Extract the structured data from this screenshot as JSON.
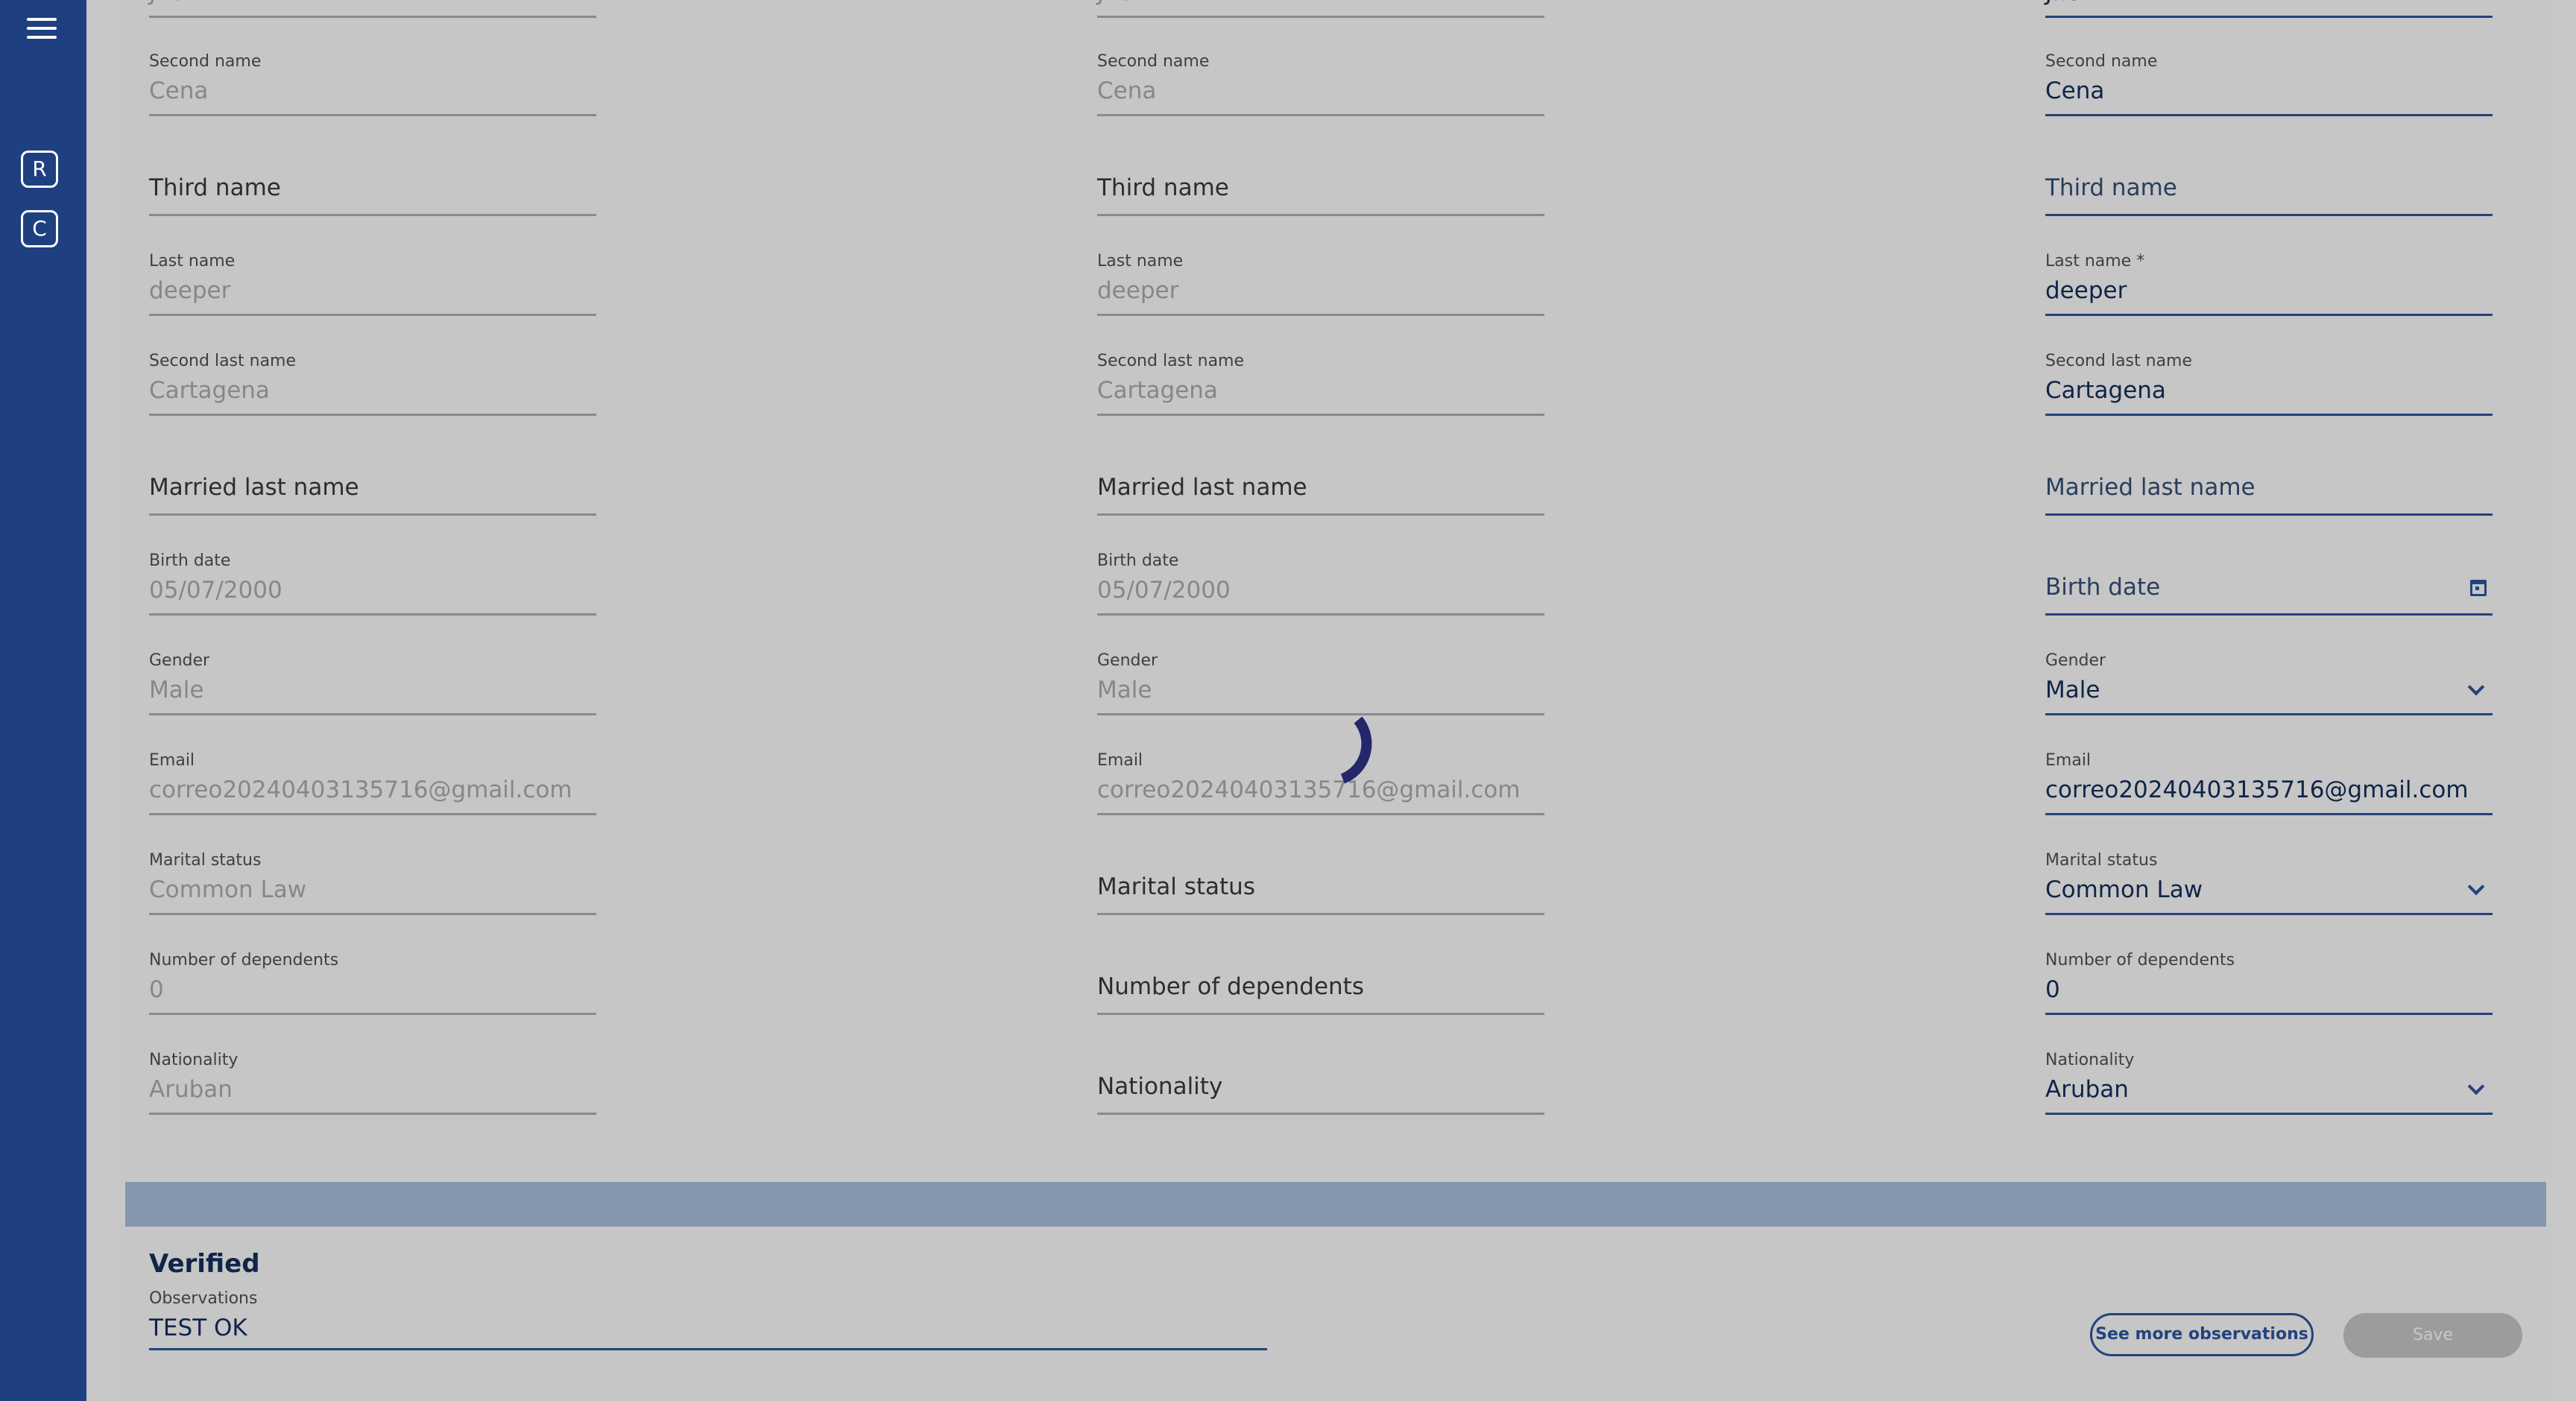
{
  "sidebar": {
    "badges": [
      "R",
      "C"
    ]
  },
  "columns": [
    {
      "first_name": "Jhon",
      "fields": [
        {
          "label": "Second name",
          "value": "Cena"
        },
        {
          "label": "",
          "placeholder": "Third name"
        },
        {
          "label": "Last name",
          "value": "deeper"
        },
        {
          "label": "Second last name",
          "value": "Cartagena"
        },
        {
          "label": "",
          "placeholder": "Married last name"
        },
        {
          "label": "Birth date",
          "value": "05/07/2000"
        },
        {
          "label": "Gender",
          "value": "Male"
        },
        {
          "label": "Email",
          "value": "correo20240403135716@gmail.com"
        },
        {
          "label": "Marital status",
          "value": "Common Law"
        },
        {
          "label": "Number of dependents",
          "value": "0"
        },
        {
          "label": "Nationality",
          "value": "Aruban"
        }
      ]
    },
    {
      "first_name": "Jhon",
      "fields": [
        {
          "label": "Second name",
          "value": "Cena"
        },
        {
          "label": "",
          "placeholder": "Third name"
        },
        {
          "label": "Last name",
          "value": "deeper"
        },
        {
          "label": "Second last name",
          "value": "Cartagena"
        },
        {
          "label": "",
          "placeholder": "Married last name"
        },
        {
          "label": "Birth date",
          "value": "05/07/2000"
        },
        {
          "label": "Gender",
          "value": "Male"
        },
        {
          "label": "Email",
          "value": "correo20240403135716@gmail.com"
        },
        {
          "label": "",
          "placeholder": "Marital status"
        },
        {
          "label": "",
          "placeholder": "Number of dependents"
        },
        {
          "label": "",
          "placeholder": "Nationality"
        }
      ]
    },
    {
      "first_name": "Jhon",
      "fields": [
        {
          "label": "Second name",
          "value": "Cena"
        },
        {
          "label": "",
          "placeholder": "Third name"
        },
        {
          "label": "Last name *",
          "value": "deeper"
        },
        {
          "label": "Second last name",
          "value": "Cartagena"
        },
        {
          "label": "",
          "placeholder": "Married last name"
        },
        {
          "label": "",
          "placeholder": "Birth date",
          "icon": "calendar-icon"
        },
        {
          "label": "Gender",
          "value": "Male",
          "icon": "chevron-down-icon"
        },
        {
          "label": "Email",
          "value": "correo20240403135716@gmail.com"
        },
        {
          "label": "Marital status",
          "value": "Common Law",
          "icon": "chevron-down-icon"
        },
        {
          "label": "Number of dependents",
          "value": "0"
        },
        {
          "label": "Nationality",
          "value": "Aruban",
          "icon": "chevron-down-icon"
        }
      ]
    }
  ],
  "verification": {
    "heading": "Verified",
    "observations_label": "Observations",
    "observations_value": "TEST OK",
    "see_more_label": "See more observations",
    "save_label": "Save"
  },
  "colors": {
    "sidebar": "#1e4080",
    "accent": "#23437c",
    "overlay_band": "#8596ae",
    "spinner": "#24276b"
  }
}
